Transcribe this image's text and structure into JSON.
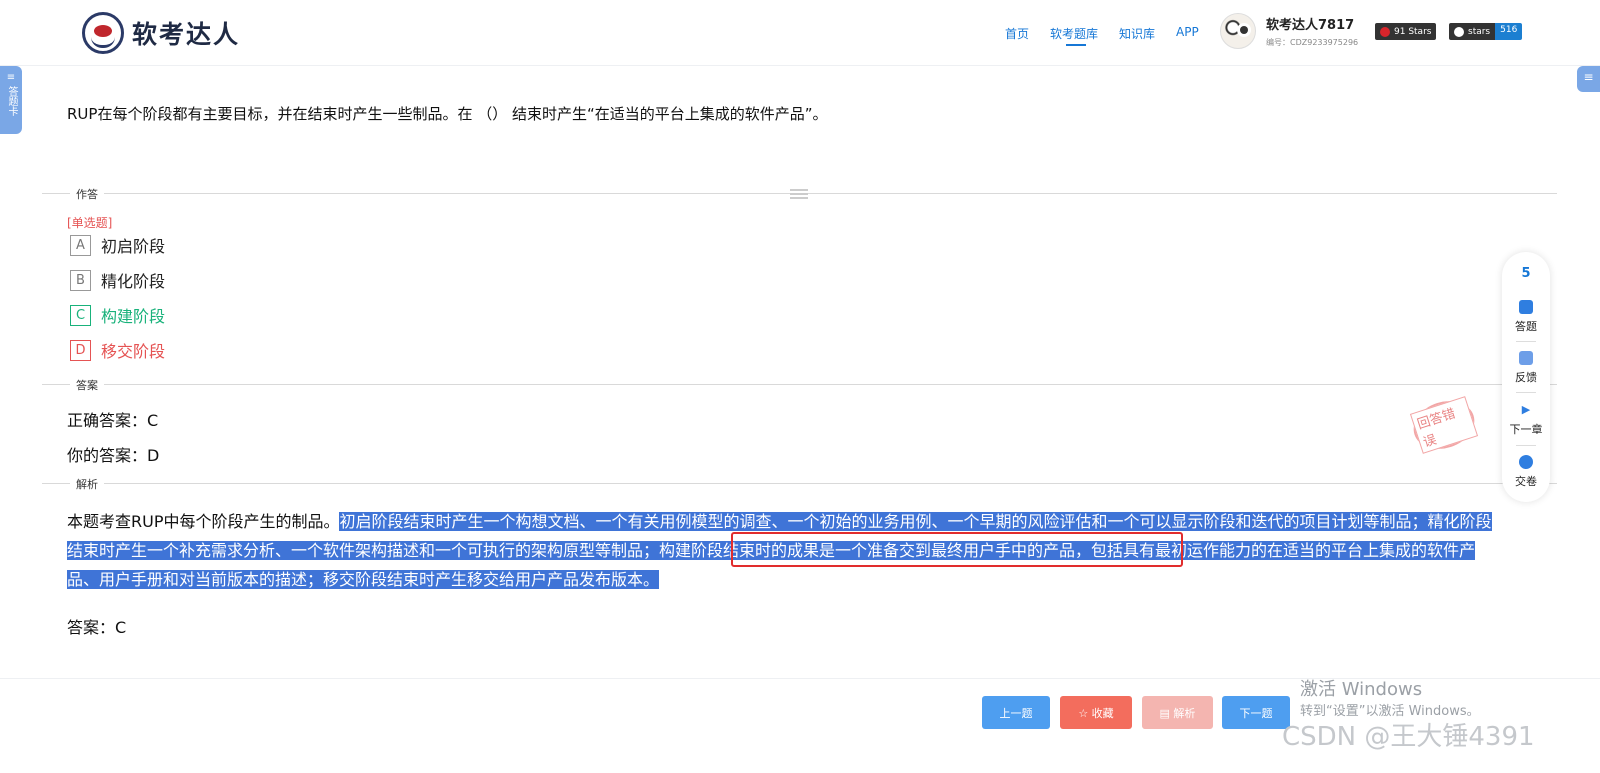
{
  "header": {
    "logo_text": "软考达人",
    "nav": [
      "首页",
      "软考题库",
      "知识库",
      "APP"
    ],
    "user_name": "软考达人7817",
    "user_id": "编号：CDZ9233975296",
    "badge1_left": "91 Stars",
    "badge2_left": "stars",
    "badge2_right": "516"
  },
  "side": {
    "left_label": "答题卡",
    "right_label": "≡"
  },
  "question": {
    "text": "RUP在每个阶段都有主要目标，并在结束时产生一些制品。在 （）  结束时产生“在适当的平台上集成的软件产品”。",
    "section_answer_label": "作答",
    "type": "[单选题]",
    "options": [
      {
        "key": "A",
        "text": "初启阶段"
      },
      {
        "key": "B",
        "text": "精化阶段"
      },
      {
        "key": "C",
        "text": "构建阶段"
      },
      {
        "key": "D",
        "text": "移交阶段"
      }
    ]
  },
  "answer": {
    "section_label": "答案",
    "correct": "正确答案：C",
    "yours": "你的答案：D",
    "stamp": "回答错误"
  },
  "analysis": {
    "section_label": "解析",
    "intro": "本题考查RUP中每个阶段产生的制品。",
    "part1": "初启阶段结束时产生一个构想文档、一个有关用例模型的调查、一个初始的业务用例、一个早期的风险评估和一个可以显示阶段和迭代的项目计划等制品；精化阶段结束时产生一个补充需求分析、一个软件架构描述和一个可执行的架构原型等制品；",
    "part2": "构建阶段结束时的成果是一个准备交到最终用户手中的产品，",
    "part3": "包括具有最初运作能力的在适当的平台上集成的软件产品、用户手册和对当前版本的描述；移交阶段结束时产生移交给用户产品发布版本。",
    "final": "答案：C"
  },
  "toolbar": {
    "count": "5",
    "items": [
      "答题",
      "反馈",
      "下一章",
      "交卷"
    ]
  },
  "footer": {
    "prev": "上一题",
    "fav": "☆ 收藏",
    "analysis": "▤ 解析",
    "next": "下一题"
  },
  "watermark": {
    "line1": "激活 Windows",
    "line2": "转到“设置”以激活 Windows。",
    "line3": "CSDN @王大锤4391"
  }
}
